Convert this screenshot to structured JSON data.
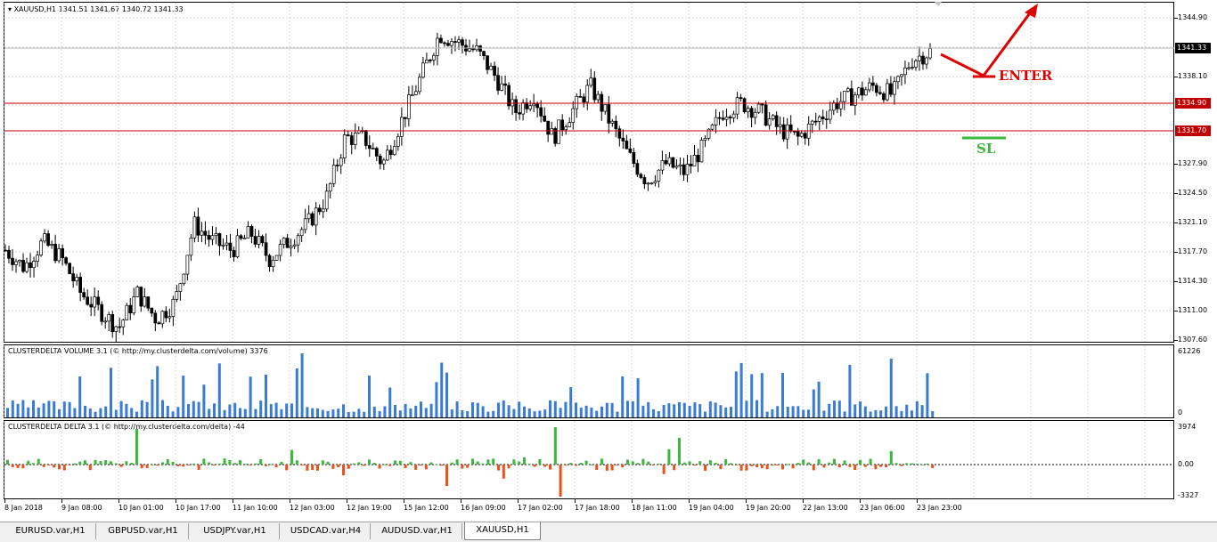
{
  "main_title": "XAUUSD,H1  1341.51 1341.67 1340.72 1341.33",
  "price_axis": [
    "1344.90",
    "1341.33",
    "1338.10",
    "1334.90",
    "1331.70",
    "1327.90",
    "1324.50",
    "1321.10",
    "1317.70",
    "1314.30",
    "1311.00",
    "1307.60"
  ],
  "price_tags": {
    "current": "1341.33",
    "upper_line": "1334.90",
    "lower_line": "1331.70"
  },
  "volume_title": "CLUSTERDELTA VOLUME 3.1 (© http://my.clusterdelta.com/volume) 3376",
  "volume_axis": {
    "max": "61226",
    "min": "0"
  },
  "delta_title": "CLUSTERDELTA DELTA 3.1 (© http://my.clusterdelta.com/delta) -44",
  "delta_axis": {
    "top": "3974",
    "zero": "0.00",
    "bottom": "-3327"
  },
  "time_axis": [
    "8 Jan 2018",
    "9 Jan 08:00",
    "10 Jan 01:00",
    "10 Jan 17:00",
    "11 Jan 10:00",
    "12 Jan 03:00",
    "12 Jan 19:00",
    "15 Jan 12:00",
    "16 Jan 09:00",
    "17 Jan 02:00",
    "17 Jan 18:00",
    "18 Jan 11:00",
    "19 Jan 04:00",
    "19 Jan 20:00",
    "22 Jan 13:00",
    "23 Jan 06:00",
    "23 Jan 23:00"
  ],
  "annotations": {
    "enter": "ENTER",
    "sl": "SL"
  },
  "colors": {
    "up_volume": "#3a7bd5",
    "delta_pos": "#3cb83c",
    "delta_neg": "#e8521c",
    "level_line": "#c00000",
    "arrow": "#e00000",
    "sl_line": "#3cb83c"
  },
  "tabs": [
    {
      "label": "EURUSD.var,H1",
      "active": false
    },
    {
      "label": "GBPUSD.var,H1",
      "active": false
    },
    {
      "label": "USDJPY.var,H1",
      "active": false
    },
    {
      "label": "USDCAD.var,H4",
      "active": false
    },
    {
      "label": "AUDUSD.var,H1",
      "active": false
    },
    {
      "label": "XAUUSD,H1",
      "active": true
    }
  ],
  "chart_data": {
    "type": "candlestick",
    "symbol": "XAUUSD,H1",
    "ylim": [
      1307.6,
      1344.9
    ],
    "levels": [
      1334.9,
      1331.7
    ],
    "current_price": 1341.33,
    "close_path": [
      1318,
      1316,
      1319,
      1317,
      1313,
      1311,
      1309,
      1313,
      1310,
      1312,
      1321,
      1319,
      1318,
      1320,
      1317,
      1319,
      1321,
      1324,
      1331,
      1331,
      1328,
      1333,
      1338,
      1343,
      1342,
      1341,
      1338,
      1334,
      1336,
      1331,
      1334,
      1337,
      1333,
      1329,
      1326,
      1328,
      1327,
      1330,
      1334,
      1335,
      1334,
      1332,
      1331,
      1333,
      1335,
      1336,
      1337,
      1336,
      1340,
      1341
    ]
  }
}
